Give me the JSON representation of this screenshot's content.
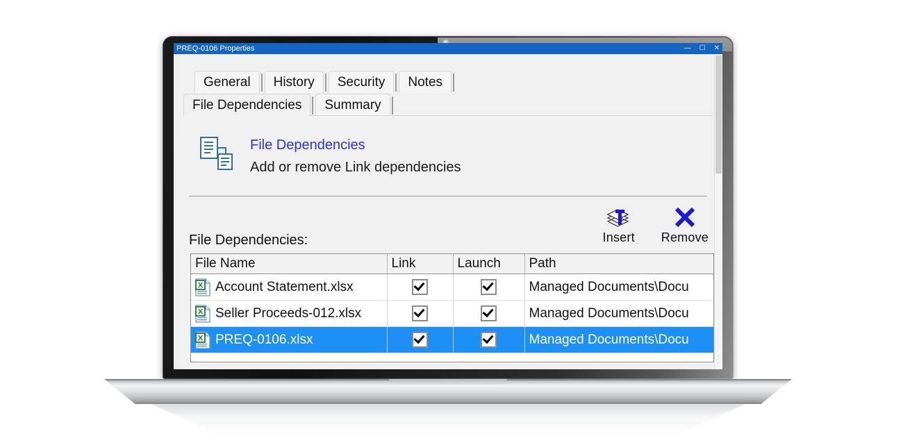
{
  "window": {
    "title": "PREQ-0106 Properties",
    "controls": [
      "—",
      "☐",
      "✕"
    ]
  },
  "tabs": {
    "row_top": [
      {
        "label": "General",
        "active": false
      },
      {
        "label": "History",
        "active": false
      },
      {
        "label": "Security",
        "active": false
      },
      {
        "label": "Notes",
        "active": false
      }
    ],
    "row_bottom": [
      {
        "label": "File Dependencies",
        "active": true
      },
      {
        "label": "Summary",
        "active": false
      }
    ]
  },
  "header": {
    "icon": "file-dependency-icon",
    "title": "File Dependencies",
    "subtitle": "Add or remove Link dependencies",
    "title_color": "#2b34d8"
  },
  "toolbar": {
    "insert": {
      "label": "Insert",
      "icon": "insert-stack-icon"
    },
    "remove": {
      "label": "Remove",
      "icon": "remove-x-icon"
    }
  },
  "list": {
    "label": "File Dependencies:",
    "columns": [
      "File Name",
      "Link",
      "Launch",
      "Path"
    ],
    "rows": [
      {
        "icon": "excel-file-icon",
        "file_name": "Account Statement.xlsx",
        "link": true,
        "launch": true,
        "path": "Managed Documents\\Docu",
        "selected": false
      },
      {
        "icon": "excel-file-icon",
        "file_name": "Seller Proceeds-012.xlsx",
        "link": true,
        "launch": true,
        "path": "Managed Documents\\Docu",
        "selected": false
      },
      {
        "icon": "excel-file-icon",
        "file_name": "PREQ-0106.xlsx",
        "link": true,
        "launch": true,
        "path": "Managed Documents\\Docu",
        "selected": true
      }
    ],
    "selection_color": "#1e90f5",
    "checkmark": "✔"
  }
}
